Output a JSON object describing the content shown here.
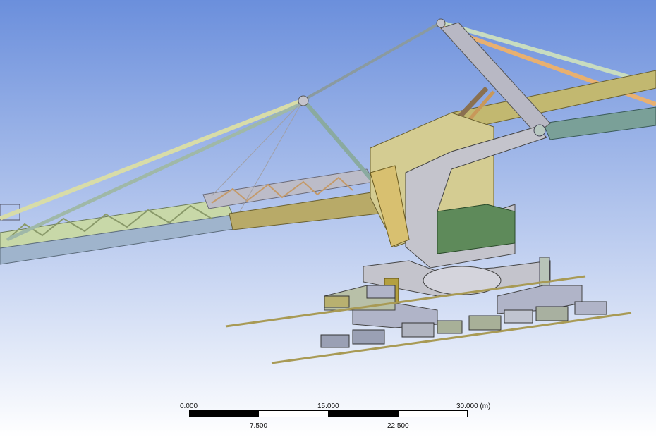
{
  "viewport": {
    "background_top": "#6b8fdc",
    "background_bottom": "#ffffff",
    "model_colors": {
      "truss_light": "#c8d8a8",
      "truss_grey": "#bcbcc8",
      "boom_beam": "#9fb4cc",
      "cable": "#b8c49a",
      "structure_grey": "#c4c4cc",
      "structure_olive": "#c2b870",
      "deck_green": "#5e8a5a",
      "rail": "#a89a55"
    }
  },
  "scale_bar": {
    "top_labels": [
      "0.000",
      "15.000",
      "30.000 (m)"
    ],
    "bottom_labels": [
      "7.500",
      "22.500"
    ]
  }
}
